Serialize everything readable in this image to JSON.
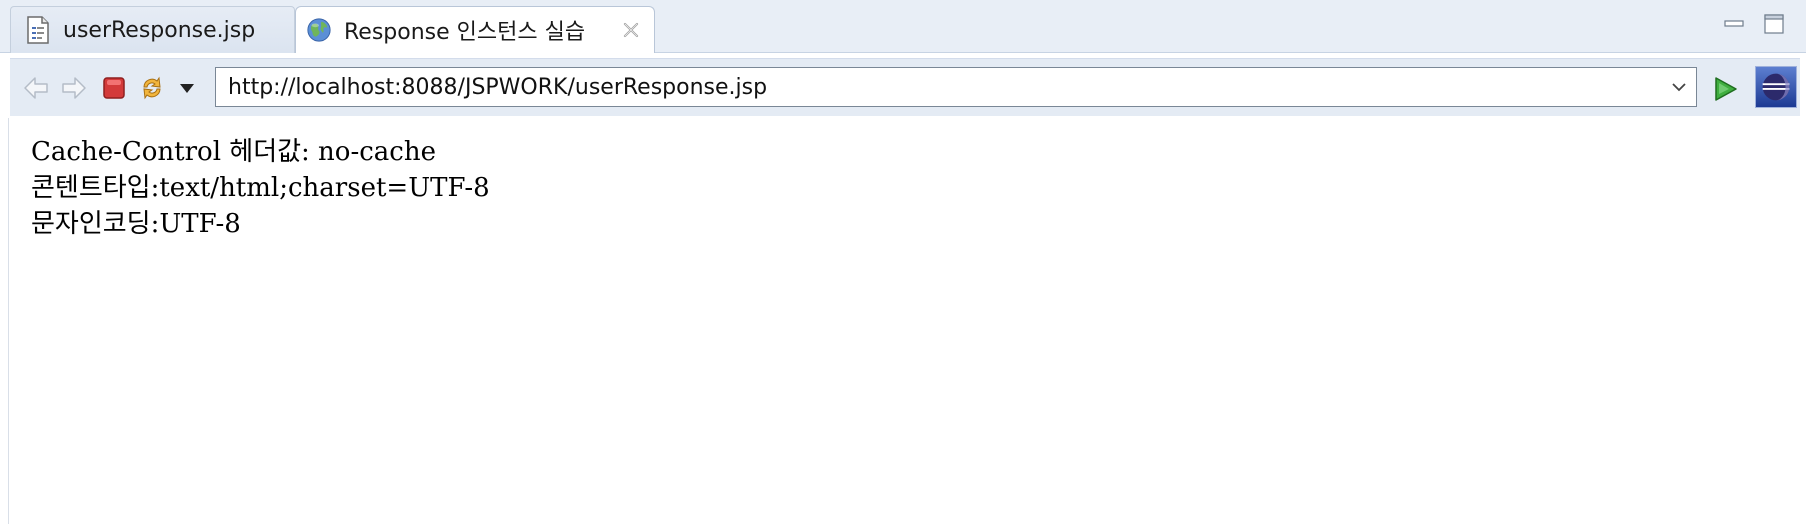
{
  "tabs": [
    {
      "label": "userResponse.jsp",
      "icon": "jsp-file-icon",
      "active": false
    },
    {
      "label": "Response 인스턴스 실습",
      "icon": "globe-icon",
      "active": true
    }
  ],
  "toolbar": {
    "url": "http://localhost:8088/JSPWORK/userResponse.jsp"
  },
  "content": {
    "lines": [
      "Cache-Control 헤더값: no-cache",
      "콘텐트타입:text/html;charset=UTF-8",
      "문자인코딩:UTF-8"
    ]
  },
  "colors": {
    "tab_bg": "#e8eef6",
    "toolbar_bg": "#e4ebf4",
    "stop_red": "#d33a3a",
    "go_green": "#3fae3f"
  }
}
